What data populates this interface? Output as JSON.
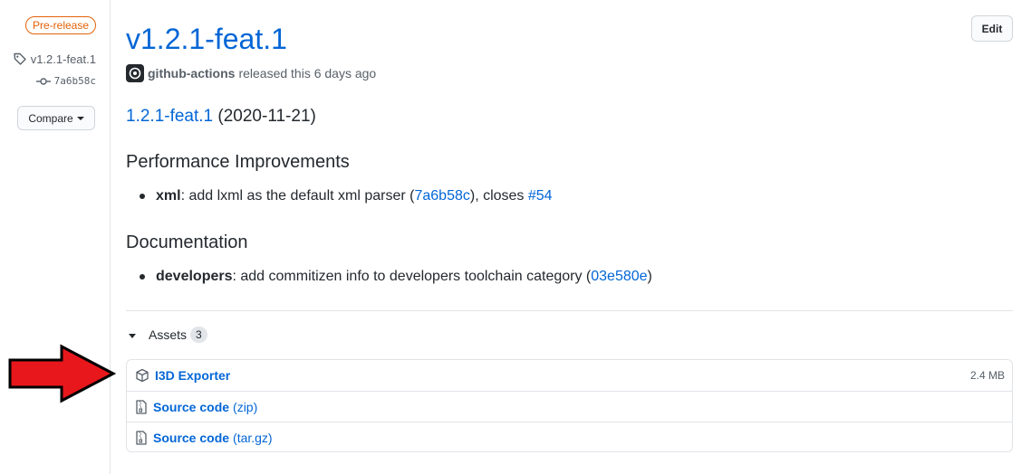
{
  "sidebar": {
    "badge": "Pre-release",
    "tag": "v1.2.1-feat.1",
    "commit": "7a6b58c",
    "compare_label": "Compare"
  },
  "header": {
    "title": "v1.2.1-feat.1",
    "edit_label": "Edit",
    "author": "github-actions",
    "released_text": "released this 6 days ago"
  },
  "notes": {
    "version_link": "1.2.1-feat.1",
    "version_date": "(2020-11-21)",
    "sections": [
      {
        "heading": "Performance Improvements",
        "items": [
          {
            "scope": "xml",
            "text": ": add lxml as the default xml parser (",
            "commit": "7a6b58c",
            "after": "), closes ",
            "issue": "#54"
          }
        ]
      },
      {
        "heading": "Documentation",
        "items": [
          {
            "scope": "developers",
            "text": ": add commitizen info to developers toolchain category (",
            "commit": "03e580e",
            "after": ")"
          }
        ]
      }
    ]
  },
  "assets": {
    "label": "Assets",
    "count": "3",
    "items": [
      {
        "name": "I3D Exporter",
        "paren": "",
        "size": "2.4 MB",
        "icon": "package-icon"
      },
      {
        "name": "Source code",
        "paren": "(zip)",
        "size": "",
        "icon": "file-zip-icon"
      },
      {
        "name": "Source code",
        "paren": "(tar.gz)",
        "size": "",
        "icon": "file-zip-icon"
      }
    ]
  },
  "colors": {
    "link": "#0366d6",
    "prerelease": "#e36209",
    "arrow": "#e8171c"
  }
}
